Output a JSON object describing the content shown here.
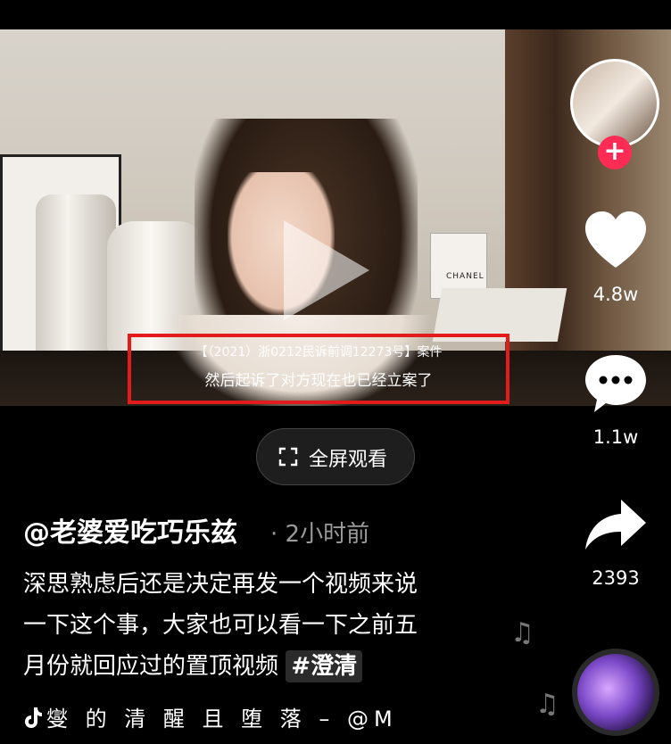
{
  "video": {
    "case_number": "【（2021）浙0212民诉前调12273号】案件",
    "subtitle": "然后起诉了对方现在也已经立案了",
    "bag_brand": "CHANEL"
  },
  "rail": {
    "like_count": "4.8w",
    "comment_count": "1.1w",
    "share_count": "2393"
  },
  "fullscreen_label": "全屏观看",
  "post": {
    "author": "@老婆爱吃巧乐兹",
    "time": "· 2小时前",
    "caption_lines": [
      "深思熟虑后还是决定再发一个视频来说",
      "一下这个事，大家也可以看一下之前五",
      "月份就回应过的置顶视频"
    ],
    "hashtag": "#澄清",
    "music": "燮 的 清 醒 且 堕 落 – @M"
  },
  "colors": {
    "highlight_box": "#e31b1b",
    "follow_button": "#fe2c55",
    "background": "#000000"
  }
}
